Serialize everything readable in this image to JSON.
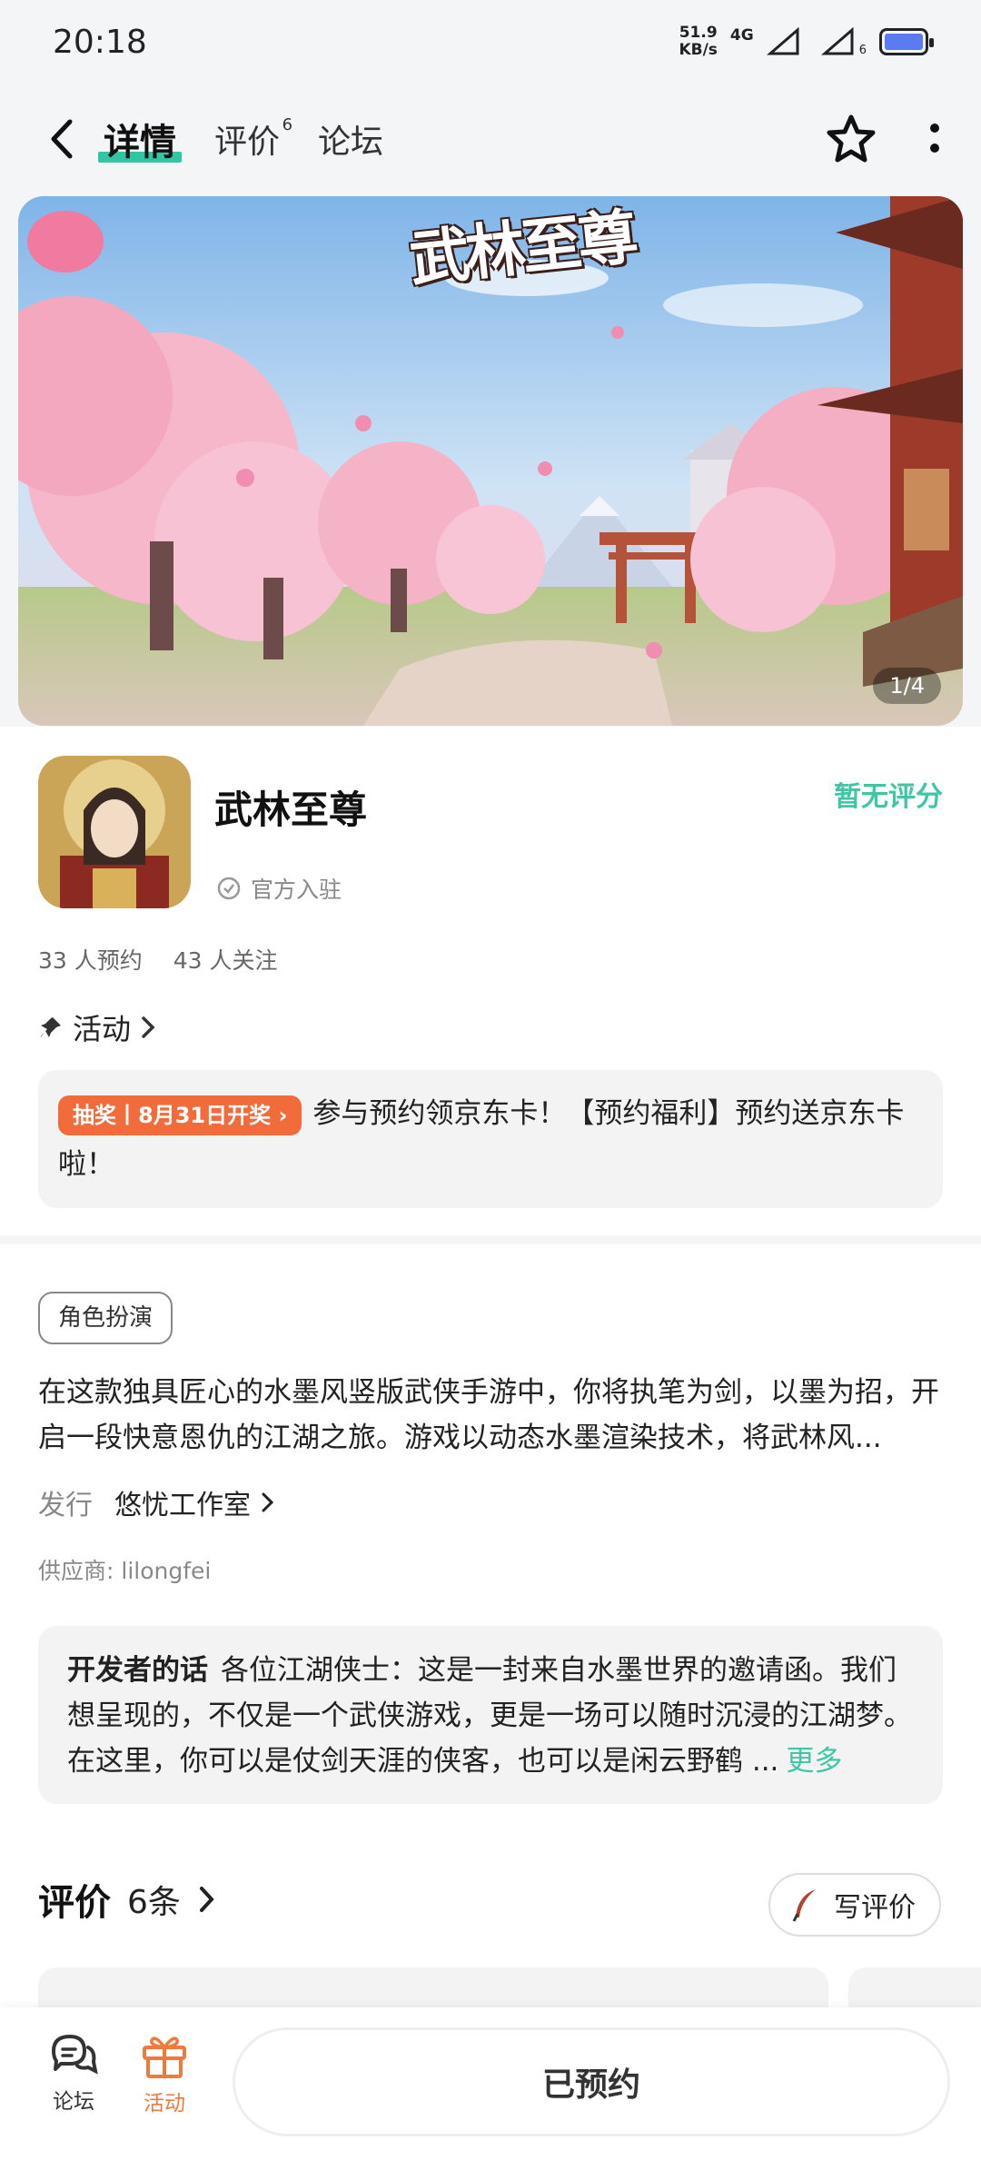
{
  "status_bar": {
    "time": "20:18",
    "net_speed_value": "51.9",
    "net_speed_unit": "KB/s",
    "network": "4G",
    "sim_slot": "6",
    "battery_color": "#5b7bf0"
  },
  "nav": {
    "tabs": [
      {
        "label": "详情",
        "active": true
      },
      {
        "label": "评价",
        "badge": "6"
      },
      {
        "label": "论坛"
      }
    ]
  },
  "banner": {
    "logo_text": "武林至尊",
    "page_indicator": "1/4"
  },
  "app": {
    "name": "武林至尊",
    "official_label": "官方入驻",
    "rating": "暂无评分",
    "reservations": "33 人预约",
    "followers": "43 人关注",
    "accent_color": "#3fc6a6"
  },
  "activity": {
    "heading": "活动",
    "tag": "抽奖丨8月31日开奖",
    "text": "参与预约领京东卡！【预约福利】预约送京东卡啦！"
  },
  "description": {
    "genre": "角色扮演",
    "text": "在这款独具匠心的水墨风竖版武侠手游中，你将执笔为剑，以墨为招，开启一段快意恩仇的江湖之旅。游戏以动态水墨渲染技术，将武林风...",
    "publisher_label": "发行",
    "publisher": "悠忧工作室",
    "supplier": "供应商: lilongfei",
    "dev_label": "开发者的话",
    "dev_text": "各位江湖侠士：这是一封来自水墨世界的邀请函。我们想呈现的，不仅是一个武侠游戏，更是一场可以随时沉浸的江湖梦。在这里，你可以是仗剑天涯的侠客，也可以是闲云野鹤 ...",
    "more": "更多"
  },
  "reviews": {
    "title": "评价",
    "count": "6条",
    "write_label": "写评价"
  },
  "bottom_bar": {
    "forum_label": "论坛",
    "activity_label": "活动",
    "reserved_label": "已预约"
  }
}
